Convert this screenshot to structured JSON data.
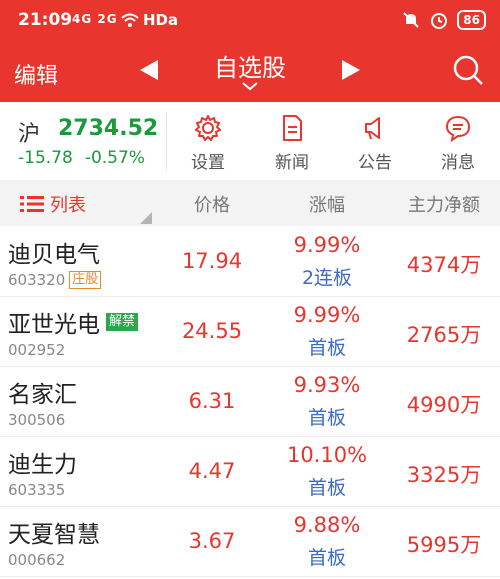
{
  "status": {
    "time": "21:09",
    "network": "4G  2G",
    "wifi_label": "HDa",
    "battery": "86",
    "icons": [
      "signal-icon",
      "wifi-icon",
      "mute-icon",
      "alarm-icon",
      "battery-icon"
    ]
  },
  "nav": {
    "edit": "编辑",
    "title": "自选股"
  },
  "index": {
    "market": "沪",
    "price": "2734.52",
    "change": "-15.78",
    "change_pct": "-0.57%"
  },
  "tools": [
    {
      "label": "设置",
      "icon": "gear-icon"
    },
    {
      "label": "新闻",
      "icon": "document-icon"
    },
    {
      "label": "公告",
      "icon": "speaker-icon"
    },
    {
      "label": "消息",
      "icon": "message-icon"
    }
  ],
  "table": {
    "headers": {
      "list": "列表",
      "price": "价格",
      "change": "涨幅",
      "flow": "主力净额"
    },
    "rows": [
      {
        "name": "迪贝电气",
        "code": "603320",
        "tag": "庄股",
        "price": "17.94",
        "pct": "9.99%",
        "board": "2连板",
        "flow": "4374万"
      },
      {
        "name": "亚世光电",
        "code": "002952",
        "tag": "解禁",
        "price": "24.55",
        "pct": "9.99%",
        "board": "首板",
        "flow": "2765万"
      },
      {
        "name": "名家汇",
        "code": "300506",
        "tag": "",
        "price": "6.31",
        "pct": "9.93%",
        "board": "首板",
        "flow": "4990万"
      },
      {
        "name": "迪生力",
        "code": "603335",
        "tag": "",
        "price": "4.47",
        "pct": "10.10%",
        "board": "首板",
        "flow": "3325万"
      },
      {
        "name": "天夏智慧",
        "code": "000662",
        "tag": "",
        "price": "3.67",
        "pct": "9.88%",
        "board": "首板",
        "flow": "5995万"
      }
    ]
  },
  "colors": {
    "accent": "#e8352d",
    "down": "#1a9a3a",
    "board": "#3b6bc4"
  }
}
